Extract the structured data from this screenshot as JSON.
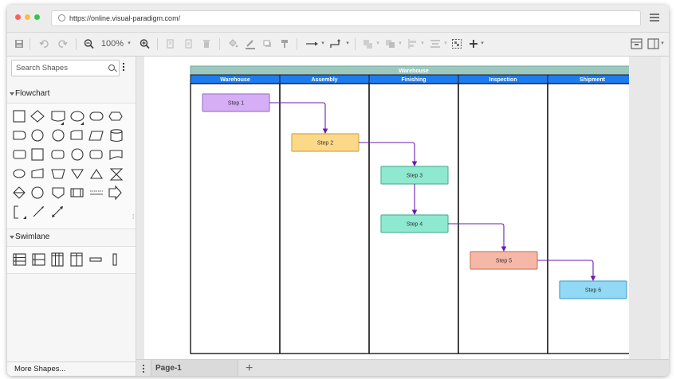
{
  "browser": {
    "url": "https://online.visual-paradigm.com/",
    "dot_colors": [
      "#fc605c",
      "#fdbc40",
      "#34c84a"
    ]
  },
  "toolbar": {
    "zoom": "100%",
    "icons": [
      "save-icon",
      "undo-icon",
      "redo-icon",
      "zoom-out-icon",
      "zoom-in-icon",
      "copy-icon",
      "paste-icon",
      "delete-icon",
      "fill-color-icon",
      "line-color-icon",
      "shadow-icon",
      "format-painter-icon",
      "connector-style-icon",
      "waypoint-style-icon",
      "to-front-icon",
      "to-back-icon",
      "align-icon",
      "distribute-icon",
      "group-icon",
      "add-icon",
      "panel-toggle-icon",
      "layout-icon"
    ]
  },
  "sidebar": {
    "search_placeholder": "Search Shapes",
    "sections": [
      {
        "label": "Flowchart"
      },
      {
        "label": "Swimlane"
      }
    ],
    "more_shapes": "More Shapes..."
  },
  "diagram": {
    "title": "Warehouse",
    "title_color": "#9dc8c0",
    "header_color": "#1e7bf0",
    "lanes": [
      "Warehouse",
      "Assembly",
      "Finishing",
      "Inspection",
      "Shipment"
    ],
    "steps": [
      {
        "label": "Step 1",
        "lane": 0,
        "fill": "#d5aef5",
        "stroke": "#a878d0"
      },
      {
        "label": "Step 2",
        "lane": 1,
        "fill": "#fcd889",
        "stroke": "#d6a94a"
      },
      {
        "label": "Step 3",
        "lane": 2,
        "fill": "#8fe8d0",
        "stroke": "#52b89a"
      },
      {
        "label": "Step 4",
        "lane": 2,
        "fill": "#8fe8d0",
        "stroke": "#52b89a"
      },
      {
        "label": "Step 5",
        "lane": 3,
        "fill": "#f5b8a6",
        "stroke": "#d27e68"
      },
      {
        "label": "Step 6",
        "lane": 4,
        "fill": "#92d9f5",
        "stroke": "#4fa7cc"
      }
    ],
    "connector_color": "#6a1bb0"
  },
  "bottom": {
    "page_tab": "Page-1"
  }
}
